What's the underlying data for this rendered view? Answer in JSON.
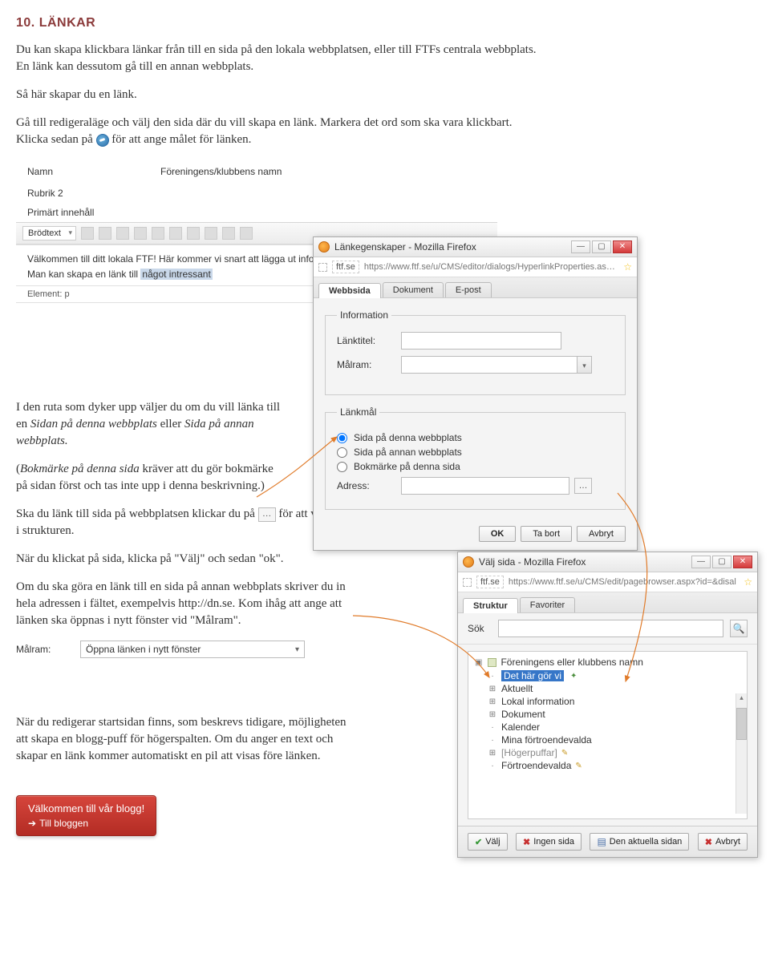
{
  "heading": "10. LÄNKAR",
  "para1": "Du kan skapa klickbara länkar från till en sida på den lokala webbplatsen, eller till FTFs centrala webbplats. En länk kan dessutom gå till en annan webbplats.",
  "para2": "Så här skapar du en länk.",
  "para3a": "Gå till redigeraläge och välj den sida där du vill skapa en länk. Markera det ord som ska vara klickbart. Klicka sedan på ",
  "para3b": " för att ange målet för länken.",
  "editor": {
    "namn_lbl": "Namn",
    "namn_val": "Föreningens/klubbens namn",
    "rubrik_lbl": "Rubrik 2",
    "primart_lbl": "Primärt innehåll",
    "brodtext": "Brödtext",
    "body_line1": "Välkommen till ditt lokala FTF! Här kommer vi snart att lägga ut information om v",
    "body_line2a": "Man kan skapa en länk till ",
    "body_line2b": "något intressant",
    "element": "Element: p"
  },
  "dialog1": {
    "title": "Länkegenskaper - Mozilla Firefox",
    "site": "ftf.se",
    "url": "https://www.ftf.se/u/CMS/editor/dialogs/HyperlinkProperties.aspx?",
    "tabs": {
      "web": "Webbsida",
      "dok": "Dokument",
      "epost": "E-post"
    },
    "info_legend": "Information",
    "linktitle_lbl": "Länktitel:",
    "malram_lbl": "Målram:",
    "lankmal_legend": "Länkmål",
    "radio1": "Sida på denna webbplats",
    "radio2": "Sida på annan webbplats",
    "radio3": "Bokmärke på denna sida",
    "adress_lbl": "Adress:",
    "ok": "OK",
    "tabort": "Ta bort",
    "avbryt": "Avbryt"
  },
  "para4a": "I den ruta som dyker upp väljer du om du vill länka till en ",
  "para4b": "Sidan på denna webbplats",
  "para4c": " eller ",
  "para4d": "Sida på annan webbplats.",
  "para5a": "(",
  "para5b": "Bokmärke på denna sida",
  "para5c": " kräver att du gör bokmärke på sidan först och tas inte upp i denna beskrivning.)",
  "para6a": "Ska du länk till sida på webbplatsen klickar du på ",
  "para6b": " för att välja sida i strukturen.",
  "para7": "När du klickat på sida, klicka på \"Välj\" och sedan \"ok\".",
  "para8": "Om du ska göra en länk till en sida på annan webbplats skriver du in hela adressen i fältet, exempelvis http://dn.se. Kom ihåg att ange att länken ska öppnas i nytt fönster vid \"Målram\".",
  "malram_select": "Öppna länken i nytt fönster",
  "malram_lbl2": "Målram:",
  "dialog2": {
    "title": "Välj sida - Mozilla Firefox",
    "site": "ftf.se",
    "url": "https://www.ftf.se/u/CMS/edit/pagebrowser.aspx?id=&disal",
    "tabs": {
      "struktur": "Struktur",
      "fav": "Favoriter"
    },
    "sok_lbl": "Sök",
    "root": "Föreningens eller klubbens namn",
    "items": [
      {
        "exp": "",
        "name": "Det här gör vi",
        "xtra": true,
        "hl": true
      },
      {
        "exp": "+",
        "name": "Aktuellt"
      },
      {
        "exp": "+",
        "name": "Lokal information"
      },
      {
        "exp": "+",
        "name": "Dokument"
      },
      {
        "exp": "",
        "name": "Kalender"
      },
      {
        "exp": "",
        "name": "Mina förtroendevalda"
      },
      {
        "exp": "+",
        "name": "[Högerpuffar]",
        "pencil": true,
        "bracket": true
      },
      {
        "exp": "",
        "name": "Förtroendevalda",
        "pencil": true
      }
    ],
    "valj": "Välj",
    "ingen": "Ingen sida",
    "aktuella": "Den aktuella sidan",
    "avbryt": "Avbryt"
  },
  "para9": "När du redigerar startsidan finns, som beskrevs tidigare, möjligheten att skapa en blogg-puff för högerspalten. Om du anger en text och skapar en länk kommer automatiskt en pil att visas före länken.",
  "blog": {
    "title": "Välkommen till vår blogg!",
    "link": "Till bloggen"
  }
}
